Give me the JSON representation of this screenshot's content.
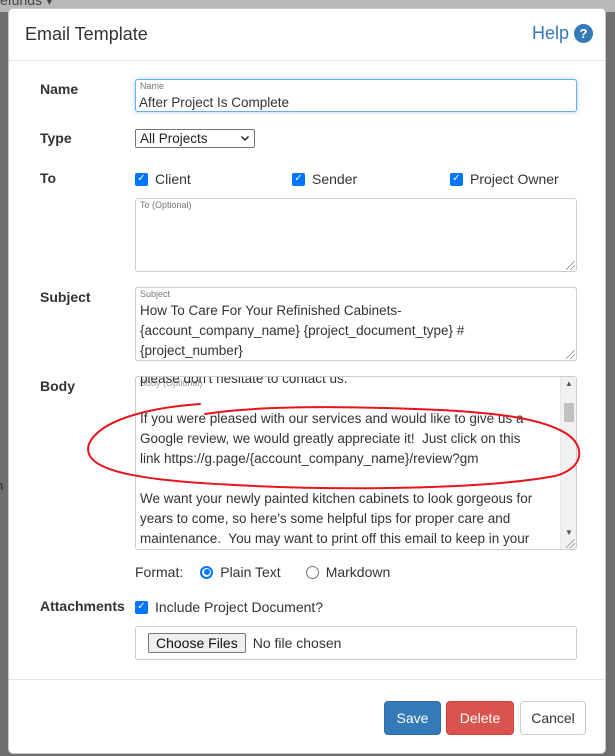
{
  "backdrop": {
    "top_text": "efunds ▾",
    "side_text": "n"
  },
  "modal": {
    "title": "Email Template",
    "help_label": "Help",
    "help_icon_glyph": "?"
  },
  "labels": {
    "name": "Name",
    "type": "Type",
    "to": "To",
    "subject": "Subject",
    "body": "Body",
    "attachments": "Attachments"
  },
  "name_field": {
    "float_label": "Name",
    "value": "After Project Is Complete"
  },
  "type_select": {
    "selected": "All Projects"
  },
  "recipients": [
    {
      "label": "Client",
      "checked": true
    },
    {
      "label": "Sender",
      "checked": true
    },
    {
      "label": "Project Owner",
      "checked": true
    }
  ],
  "to_field": {
    "float_label": "To (Optional)",
    "value": ""
  },
  "subject_field": {
    "float_label": "Subject",
    "value": "How To Care For Your Refinished Cabinets-\n{account_company_name} {project_document_type} #\n{project_number}"
  },
  "body_field": {
    "float_label": "Body (Optional)",
    "value": "please don't hesitate to contact us.\n\nIf you were pleased with our services and would like to give us a\nGoogle review, we would greatly appreciate it!  Just click on this\nlink https://g.page/{account_company_name}/review?gm\n\nWe want your newly painted kitchen cabinets to look gorgeous for\nyears to come, so here's some helpful tips for proper care and\nmaintenance.  You may want to print off this email to keep in your"
  },
  "format": {
    "label": "Format:",
    "options": [
      {
        "label": "Plain Text",
        "selected": true
      },
      {
        "label": "Markdown",
        "selected": false
      }
    ]
  },
  "attachments": {
    "include_label": "Include Project Document?",
    "include_checked": true,
    "choose_button": "Choose Files",
    "no_file_text": "No file chosen"
  },
  "footer": {
    "save": "Save",
    "delete": "Delete",
    "cancel": "Cancel"
  },
  "colors": {
    "primary": "#337ab7",
    "danger": "#d9534f",
    "checkbox": "#0075ff",
    "annotation": "#e8141b"
  }
}
